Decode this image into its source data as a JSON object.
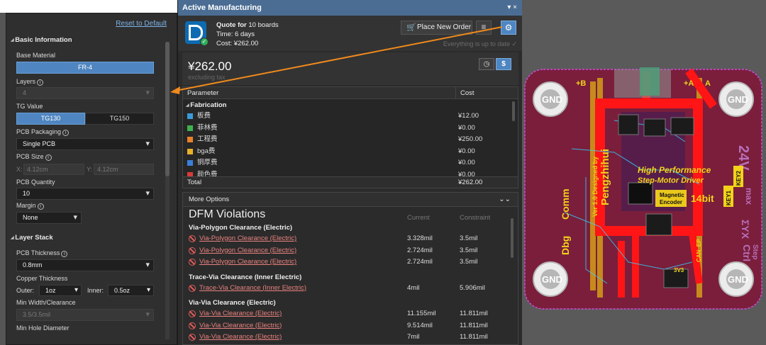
{
  "left_panel": {
    "reset_label": "Reset to Default",
    "basic_info_header": "Basic Information",
    "base_material_label": "Base Material",
    "base_material_value": "FR-4",
    "layers_label": "Layers",
    "layers_value": "4",
    "tg_label": "TG Value",
    "tg_options": [
      "TG130",
      "TG150"
    ],
    "packaging_label": "PCB Packaging",
    "packaging_value": "Single PCB",
    "size_label": "PCB Size",
    "size_x_label": "X:",
    "size_x_value": "4.12cm",
    "size_y_label": "Y:",
    "size_y_value": "4.12cm",
    "quantity_label": "PCB Quantity",
    "quantity_value": "10",
    "margin_label": "Margin",
    "margin_value": "None",
    "layer_stack_header": "Layer Stack",
    "thickness_label": "PCB Thickness",
    "thickness_value": "0.8mm",
    "copper_label": "Copper Thickness",
    "outer_label": "Outer:",
    "outer_value": "1oz",
    "inner_label": "Inner:",
    "inner_value": "0.5oz",
    "min_width_label": "Min Width/Clearance",
    "min_width_value": "3.5/3.5mil",
    "min_hole_label": "Min Hole Diameter"
  },
  "panel": {
    "title": "Active Manufacturing",
    "controls": "▾ ×",
    "quote_prefix": "Quote for",
    "quote_boards": "10 boards",
    "time": "Time: 6 days",
    "cost": "Cost: ¥262.00",
    "place_order_label": "Place New Order",
    "up_to_date": "Everything is up to date",
    "price_big": "¥262.00",
    "price_note": "excluding tax"
  },
  "param_table": {
    "col_parameter": "Parameter",
    "col_cost": "Cost",
    "section": "Fabrication",
    "rows": [
      {
        "name": "板费",
        "cost": "¥12.00",
        "color": "#3a9ad9"
      },
      {
        "name": "菲林费",
        "cost": "¥0.00",
        "color": "#3fb24f"
      },
      {
        "name": "工程费",
        "cost": "¥250.00",
        "color": "#e8812a"
      },
      {
        "name": "bga费",
        "cost": "¥0.00",
        "color": "#e8b12a"
      },
      {
        "name": "铜厚费",
        "cost": "¥0.00",
        "color": "#3a7fd9"
      },
      {
        "name": "颜色费",
        "cost": "¥0.00",
        "color": "#d93a3a"
      }
    ],
    "total_label": "Total",
    "total_value": "¥262.00"
  },
  "more_options": {
    "header": "More Options",
    "dfm_title": "DFM Violations",
    "col_current": "Current",
    "col_constraint": "Constraint",
    "groups": [
      {
        "title": "Via-Polygon Clearance (Electric)",
        "rows": [
          {
            "name": "Via-Polygon Clearance (Electric)",
            "current": "3.328mil",
            "constraint": "3.5mil"
          },
          {
            "name": "Via-Polygon Clearance (Electric)",
            "current": "2.724mil",
            "constraint": "3.5mil"
          },
          {
            "name": "Via-Polygon Clearance (Electric)",
            "current": "2.724mil",
            "constraint": "3.5mil"
          }
        ]
      },
      {
        "title": "Trace-Via Clearance (Inner Electric)",
        "rows": [
          {
            "name": "Trace-Via Clearance (Inner Electric)",
            "current": "4mil",
            "constraint": "5.906mil"
          }
        ]
      },
      {
        "title": "Via-Via Clearance (Electric)",
        "rows": [
          {
            "name": "Via-Via Clearance (Electric)",
            "current": "11.155mil",
            "constraint": "11.811mil"
          },
          {
            "name": "Via-Via Clearance (Electric)",
            "current": "9.514mil",
            "constraint": "11.811mil"
          },
          {
            "name": "Via-Via Clearance (Electric)",
            "current": "7mil",
            "constraint": "11.811mil"
          }
        ]
      }
    ]
  },
  "pcb": {
    "gnd": "GND",
    "silk_1": "High Performance",
    "silk_2": "Step-Motor Driver",
    "author": "Pengzhihui",
    "version": "Ver 1.0 Designed by",
    "comm": "Comm",
    "dbg": "Dbg",
    "magnetic": "Magnetic",
    "encoder": "Encoder",
    "bits": "14bit",
    "key1": "KEY1",
    "key2": "KEY2",
    "plus_a": "+A",
    "minus_a": "A",
    "plus_b": "+B",
    "v24": "24V",
    "can": "CAN_EP",
    "v3": "3V3",
    "max": "max",
    "syx": "ΣYX",
    "ctrl": "Ctrl",
    "step": "Step"
  }
}
